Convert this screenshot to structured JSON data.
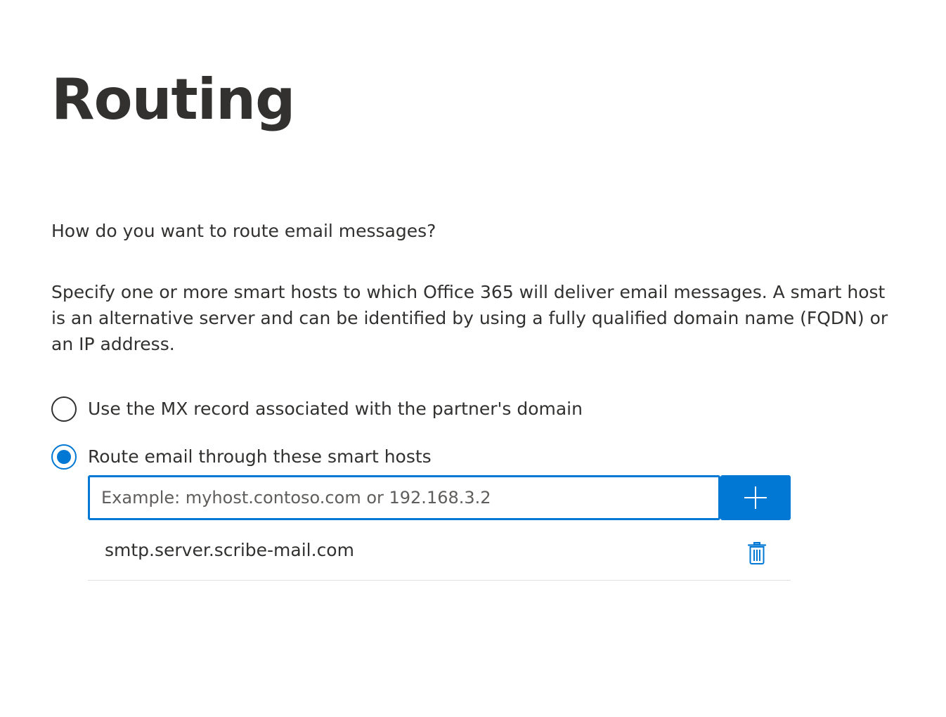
{
  "page": {
    "title": "Routing",
    "question": "How do you want to route email messages?",
    "description": "Specify one or more smart hosts to which Office 365 will deliver email messages. A smart host is an alternative server and can be identified by using a fully qualified domain name (FQDN) or an IP address."
  },
  "routing_options": [
    {
      "label": "Use the MX record associated with the partner's domain",
      "selected": false
    },
    {
      "label": "Route email through these smart hosts",
      "selected": true
    }
  ],
  "smart_host_input": {
    "value": "",
    "placeholder": "Example: myhost.contoso.com or 192.168.3.2"
  },
  "add_button": {
    "icon": "plus-icon"
  },
  "smart_hosts": [
    {
      "host": "smtp.server.scribe-mail.com",
      "icon": "trash-icon"
    }
  ],
  "colors": {
    "accent": "#0078d4",
    "text": "#323130",
    "divider": "#e1dfdd"
  }
}
